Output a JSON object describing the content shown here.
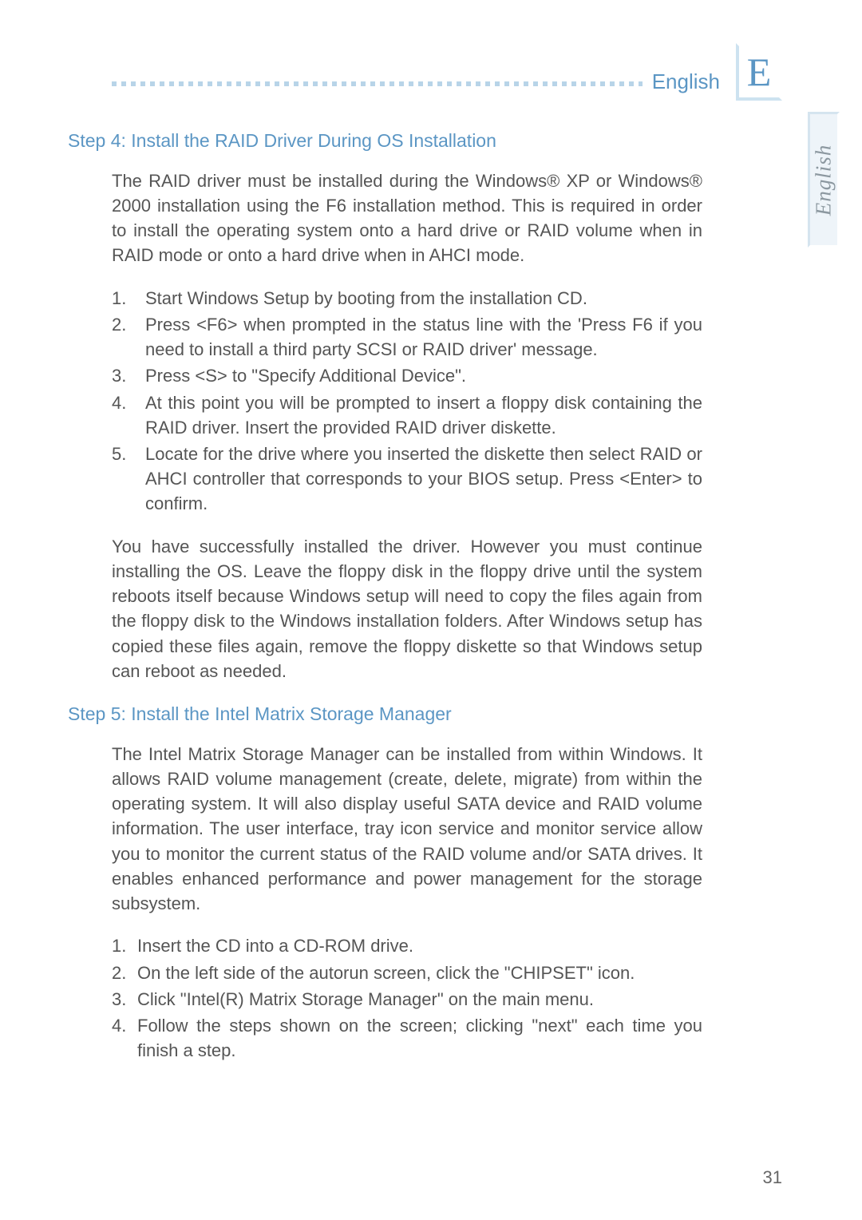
{
  "header": {
    "language_label": "English",
    "badge_letter": "E",
    "side_tab_label": "English"
  },
  "step4": {
    "heading": "Step 4: Install the RAID Driver During OS Installation",
    "intro": "The RAID driver must be installed during the Windows® XP or Windows® 2000 installation using the F6 installation method. This is required in order to install the operating system onto a hard drive or RAID volume when in RAID mode or onto a hard drive when in AHCI mode.",
    "items": [
      {
        "n": "1.",
        "t": "Start Windows Setup by booting from the installation CD."
      },
      {
        "n": "2.",
        "t": "Press <F6> when prompted in the status line with the 'Press F6 if you need to install a third party SCSI or RAID driver' message."
      },
      {
        "n": "3.",
        "t": "Press <S> to \"Specify Additional Device\"."
      },
      {
        "n": "4.",
        "t": "At this point you will be prompted to insert a floppy disk containing the RAID driver. Insert the provided RAID driver diskette."
      },
      {
        "n": "5.",
        "t": "Locate for the drive where you inserted the diskette then select RAID or AHCI controller that corresponds to your BIOS setup. Press <Enter> to confirm."
      }
    ],
    "outro": "You have successfully installed the driver. However you must continue installing the OS. Leave the floppy disk in the floppy drive until the system reboots itself because Windows setup will need to copy the files again from the floppy disk to the Windows installation folders. After Windows setup has copied these files again, remove the floppy diskette so that Windows setup can reboot as needed."
  },
  "step5": {
    "heading": "Step 5: Install the Intel Matrix Storage Manager",
    "intro": "The Intel Matrix Storage Manager can be installed from within Windows. It allows RAID volume management (create, delete, migrate) from within the operating system. It will also display useful SATA device and RAID volume information. The user interface, tray icon service and monitor service allow you to monitor the current status of the RAID volume and/or SATA drives. It enables enhanced performance and power management for the storage subsystem.",
    "items": [
      {
        "n": "1.",
        "t": "Insert the CD into a CD-ROM drive."
      },
      {
        "n": "2.",
        "t": "On the left side of the autorun screen, click the \"CHIPSET\" icon."
      },
      {
        "n": "3.",
        "t": "Click \"Intel(R) Matrix Storage Manager\" on the main menu."
      },
      {
        "n": "4.",
        "t": "Follow the steps shown on the screen; clicking \"next\" each time you finish a step."
      }
    ]
  },
  "page_number": "31"
}
